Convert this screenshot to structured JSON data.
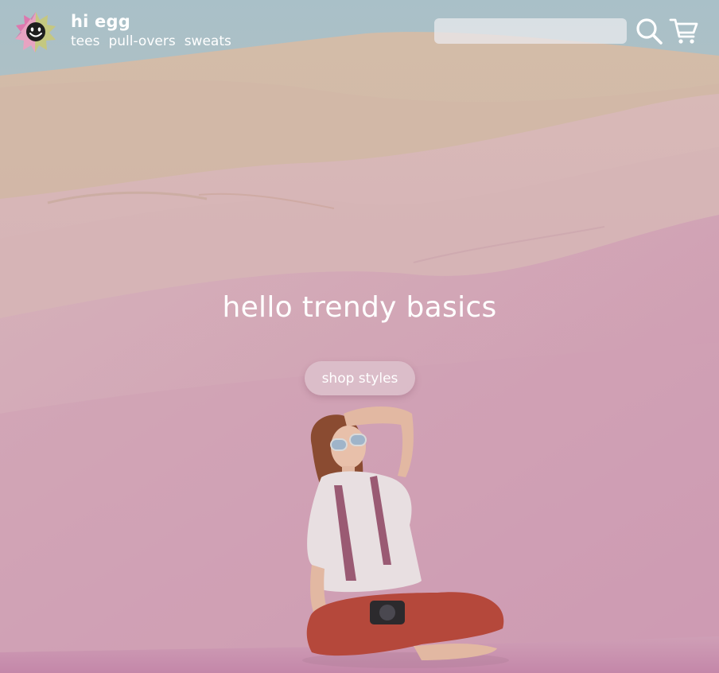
{
  "brand": {
    "name": "hi egg",
    "logo_icon": "sun-smiley-icon"
  },
  "nav": {
    "items": [
      {
        "label": "tees"
      },
      {
        "label": "pull-overs"
      },
      {
        "label": "sweats"
      }
    ]
  },
  "search": {
    "value": "",
    "placeholder": "",
    "button_icon": "search-icon"
  },
  "cart": {
    "icon": "cart-icon"
  },
  "hero": {
    "headline": "hello trendy basics",
    "cta_label": "shop styles",
    "background": "desert-dunes-with-seated-woman"
  },
  "colors": {
    "text": "#ffffff",
    "sky": "#b9c7c9",
    "sand": "#d4b8b0",
    "overlay_pink": "#c784ab",
    "pants_red": "#b5483b"
  }
}
